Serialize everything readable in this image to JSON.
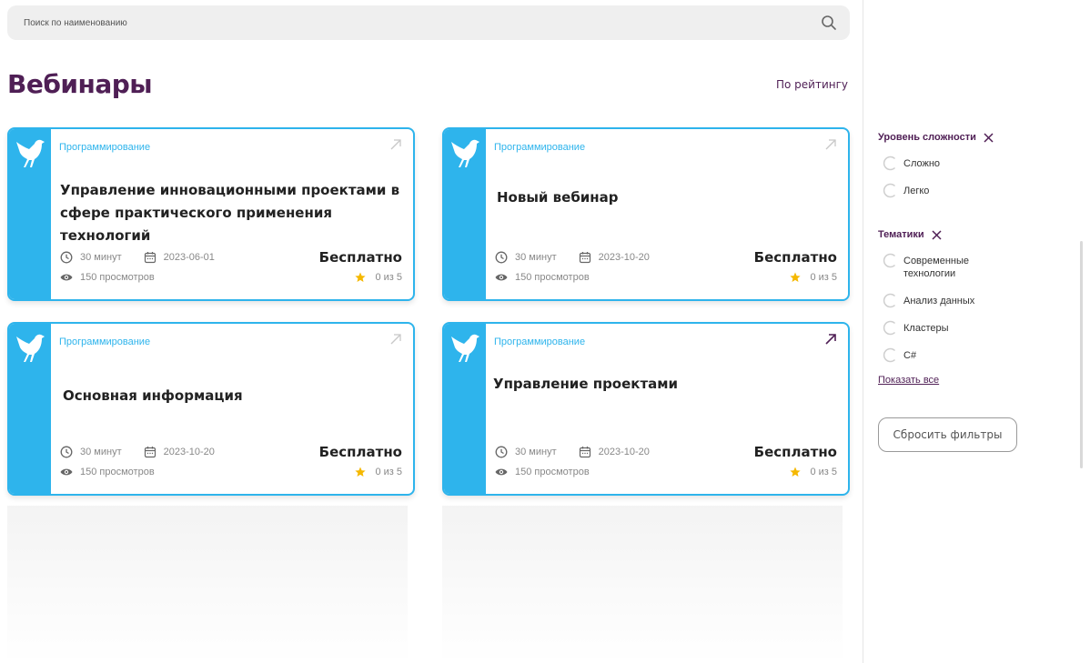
{
  "search": {
    "placeholder": "Поиск по наименованию"
  },
  "page": {
    "title": "Вебинары",
    "sort_label": "По рейтингу"
  },
  "colors": {
    "accent": "#2eb4ec",
    "brand": "#4f1f55",
    "star": "#f5b800"
  },
  "cards": [
    {
      "category": "Программирование",
      "title": "Управление инновационными проектами в сфере практического применения технологий",
      "duration": "30 минут",
      "date": "2023-06-01",
      "views": "150 просмотров",
      "price": "Бесплатно",
      "rating": "0 из 5",
      "arrow_active": false
    },
    {
      "category": "Программирование",
      "title": "Новый вебинар",
      "duration": "30 минут",
      "date": "2023-10-20",
      "views": "150 просмотров",
      "price": "Бесплатно",
      "rating": "0 из 5",
      "arrow_active": false
    },
    {
      "category": "Программирование",
      "title": "Основная информация",
      "duration": "30 минут",
      "date": "2023-10-20",
      "views": "150 просмотров",
      "price": "Бесплатно",
      "rating": "0 из 5",
      "arrow_active": false
    },
    {
      "category": "Программирование",
      "title": "Управление проектами",
      "duration": "30 минут",
      "date": "2023-10-20",
      "views": "150 просмотров",
      "price": "Бесплатно",
      "rating": "0 из 5",
      "arrow_active": true
    }
  ],
  "filters": {
    "difficulty": {
      "heading": "Уровень сложности",
      "options": [
        "Сложно",
        "Легко"
      ]
    },
    "topics": {
      "heading": "Тематики",
      "options": [
        "Современные технологии",
        "Анализ данных",
        "Кластеры",
        "C#"
      ]
    },
    "show_all": "Показать все",
    "reset_label": "Сбросить фильтры"
  }
}
